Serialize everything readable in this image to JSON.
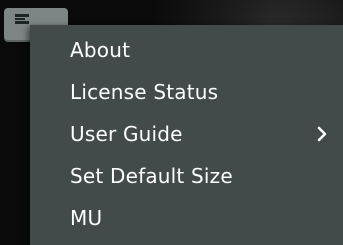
{
  "menu": {
    "items": [
      {
        "label": "About"
      },
      {
        "label": "License Status"
      },
      {
        "label": "User Guide",
        "submenu_icon": "chevron-right-icon"
      },
      {
        "label": "Set Default Size"
      },
      {
        "label": "MU"
      }
    ]
  },
  "colors": {
    "menu_background": "#434a4a",
    "menu_text": "#ffffff",
    "trigger_background": "#7d8585"
  }
}
